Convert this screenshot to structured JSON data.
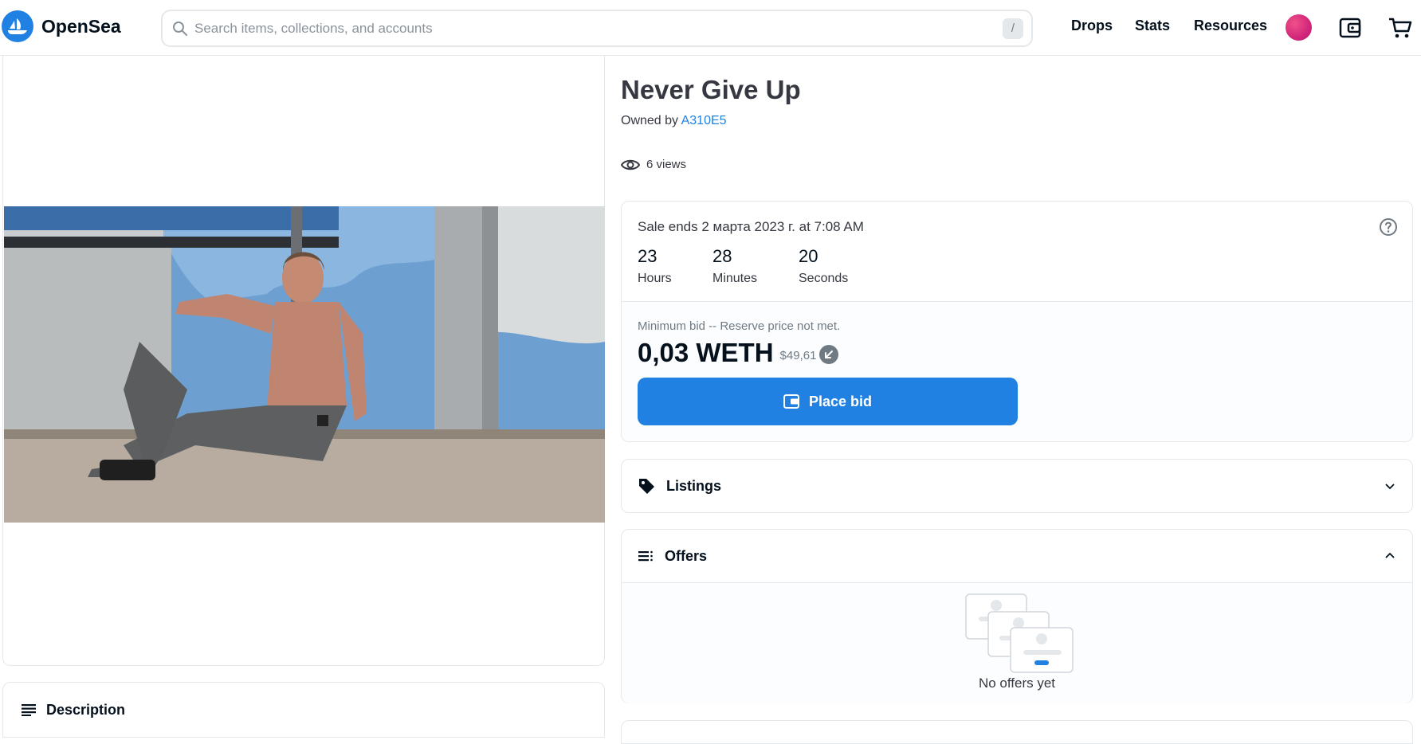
{
  "header": {
    "brand": "OpenSea",
    "search_placeholder": "Search items, collections, and accounts",
    "search_shortcut": "/",
    "nav": [
      "Drops",
      "Stats",
      "Resources"
    ],
    "icons": [
      "search-icon",
      "profile-avatar",
      "wallet-icon",
      "cart-icon"
    ]
  },
  "item": {
    "title": "Never Give Up",
    "owned_by_label": "Owned by",
    "owner": "A310E5",
    "views": "6 views"
  },
  "sale": {
    "ends_text": "Sale ends 2 марта 2023 г. at 7:08 AM",
    "countdown": [
      {
        "value": "23",
        "label": "Hours"
      },
      {
        "value": "28",
        "label": "Minutes"
      },
      {
        "value": "20",
        "label": "Seconds"
      }
    ],
    "min_bid_text": "Minimum bid -- Reserve price not met.",
    "price": "0,03 WETH",
    "price_usd": "$49,61",
    "bid_button": "Place bid"
  },
  "panels": {
    "listings": "Listings",
    "offers": "Offers",
    "offers_empty": "No offers yet",
    "description": "Description"
  },
  "colors": {
    "accent": "#2081e2",
    "text": "#04111d",
    "border": "#e5e8eb"
  }
}
